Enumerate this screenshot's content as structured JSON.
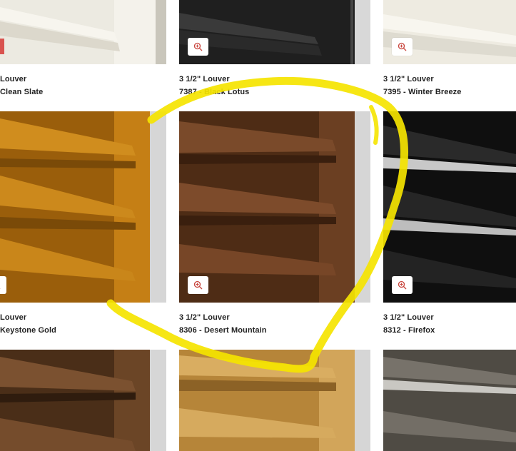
{
  "tiles": [
    {
      "id": "r0c0",
      "line1": "Louver",
      "line2": "Clean Slate",
      "color": "#e9e6da"
    },
    {
      "id": "r0c1",
      "line1": "3 1/2\" Louver",
      "line2": "7387 - Black Lotus",
      "color": "#2b2b2b"
    },
    {
      "id": "r0c2",
      "line1": "3 1/2\" Louver",
      "line2": "7395 - Winter Breeze",
      "color": "#ebe8dc"
    },
    {
      "id": "r1c0",
      "line1": "Louver",
      "line2": "Keystone Gold",
      "color": "#b8720f"
    },
    {
      "id": "r1c1",
      "line1": "3 1/2\" Louver",
      "line2": "8306 - Desert Mountain",
      "color": "#6b3f22"
    },
    {
      "id": "r1c2",
      "line1": "3 1/2\" Louver",
      "line2": "8312 - Firefox",
      "color": "#1a1a1a"
    },
    {
      "id": "r2c0",
      "line1": "",
      "line2": "",
      "color": "#6b4526"
    },
    {
      "id": "r2c1",
      "line1": "",
      "line2": "",
      "color": "#c99b4c"
    },
    {
      "id": "r2c2",
      "line1": "",
      "line2": "",
      "color": "#6b665c"
    }
  ],
  "icons": {
    "zoom": "zoom-in-icon"
  },
  "colors": {
    "highlight": "#f5e400",
    "zoom_icon": "#c9473f"
  }
}
